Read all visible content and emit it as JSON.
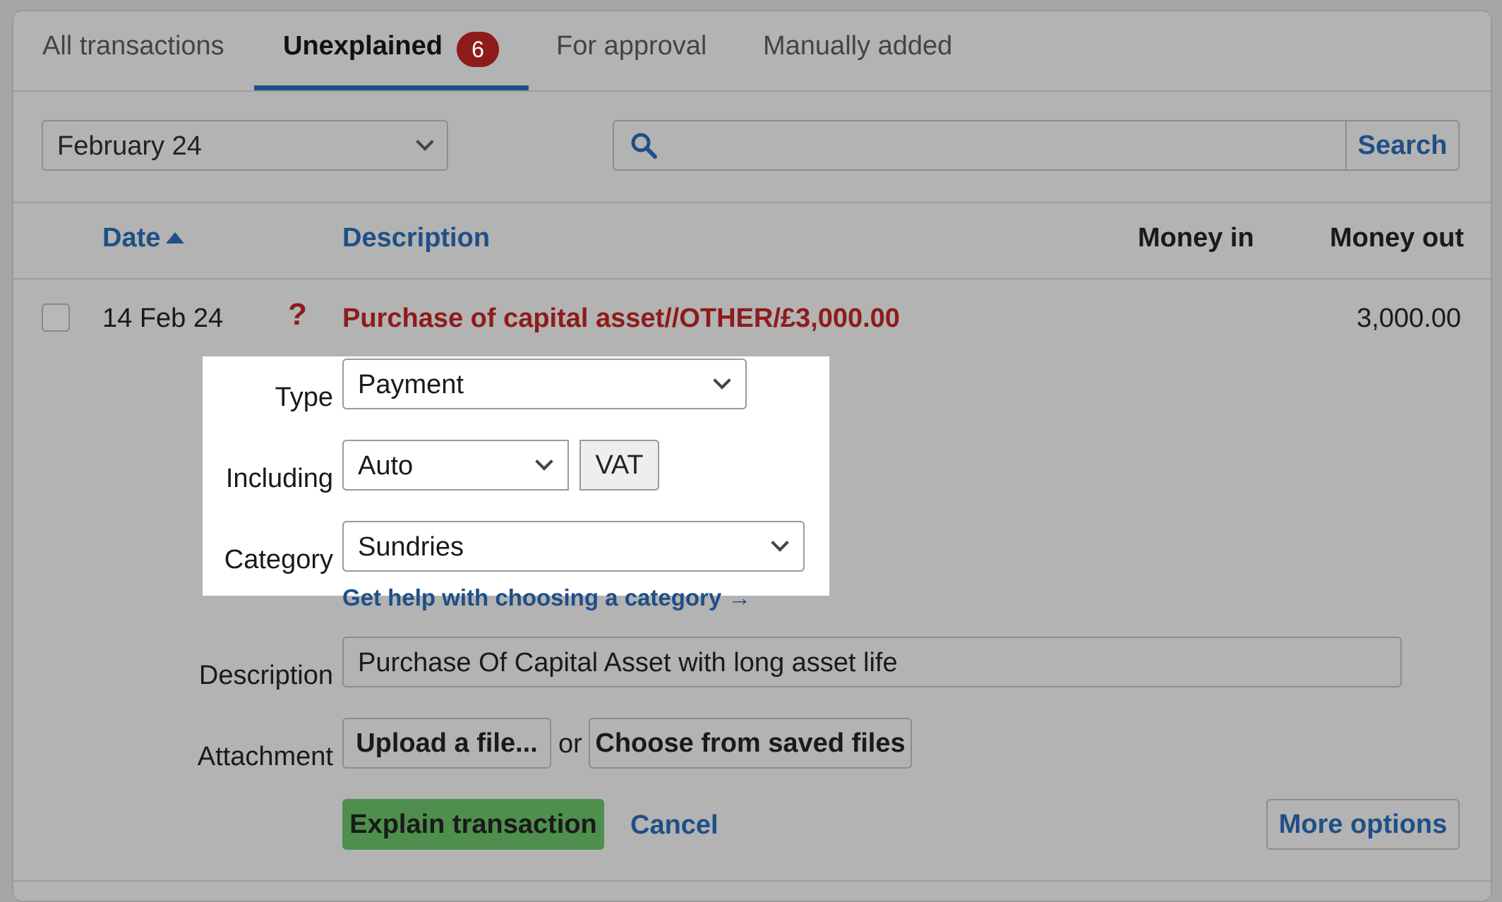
{
  "tabs": [
    {
      "label": "All transactions",
      "active": false
    },
    {
      "label": "Unexplained",
      "active": true,
      "badge": "6"
    },
    {
      "label": "For approval",
      "active": false
    },
    {
      "label": "Manually added",
      "active": false
    }
  ],
  "filters": {
    "month": "February 24",
    "search_value": "",
    "search_button": "Search"
  },
  "columns": {
    "date": "Date",
    "description": "Description",
    "money_in": "Money in",
    "money_out": "Money out"
  },
  "transaction": {
    "date": "14 Feb 24",
    "status_icon": "question-mark",
    "description": "Purchase of capital asset//OTHER/£3,000.00",
    "money_in": "",
    "money_out": "3,000.00"
  },
  "form": {
    "type_label": "Type",
    "type_value": "Payment",
    "including_label": "Including",
    "including_value": "Auto",
    "vat_addon": "VAT",
    "category_label": "Category",
    "category_value": "Sundries",
    "help_link": "Get help with choosing a category →",
    "description_label": "Description",
    "description_value": "Purchase Of Capital Asset with long asset life",
    "attachment_label": "Attachment",
    "upload_button": "Upload a file...",
    "or_text": "or",
    "choose_saved_button": "Choose from saved files",
    "explain_button": "Explain transaction",
    "cancel_link": "Cancel",
    "more_options_button": "More options"
  },
  "colors": {
    "accent": "#1f4f86",
    "danger": "#8e1b1b",
    "primary_button": "#4e8f4e",
    "overlay": "#a6a6a6"
  }
}
